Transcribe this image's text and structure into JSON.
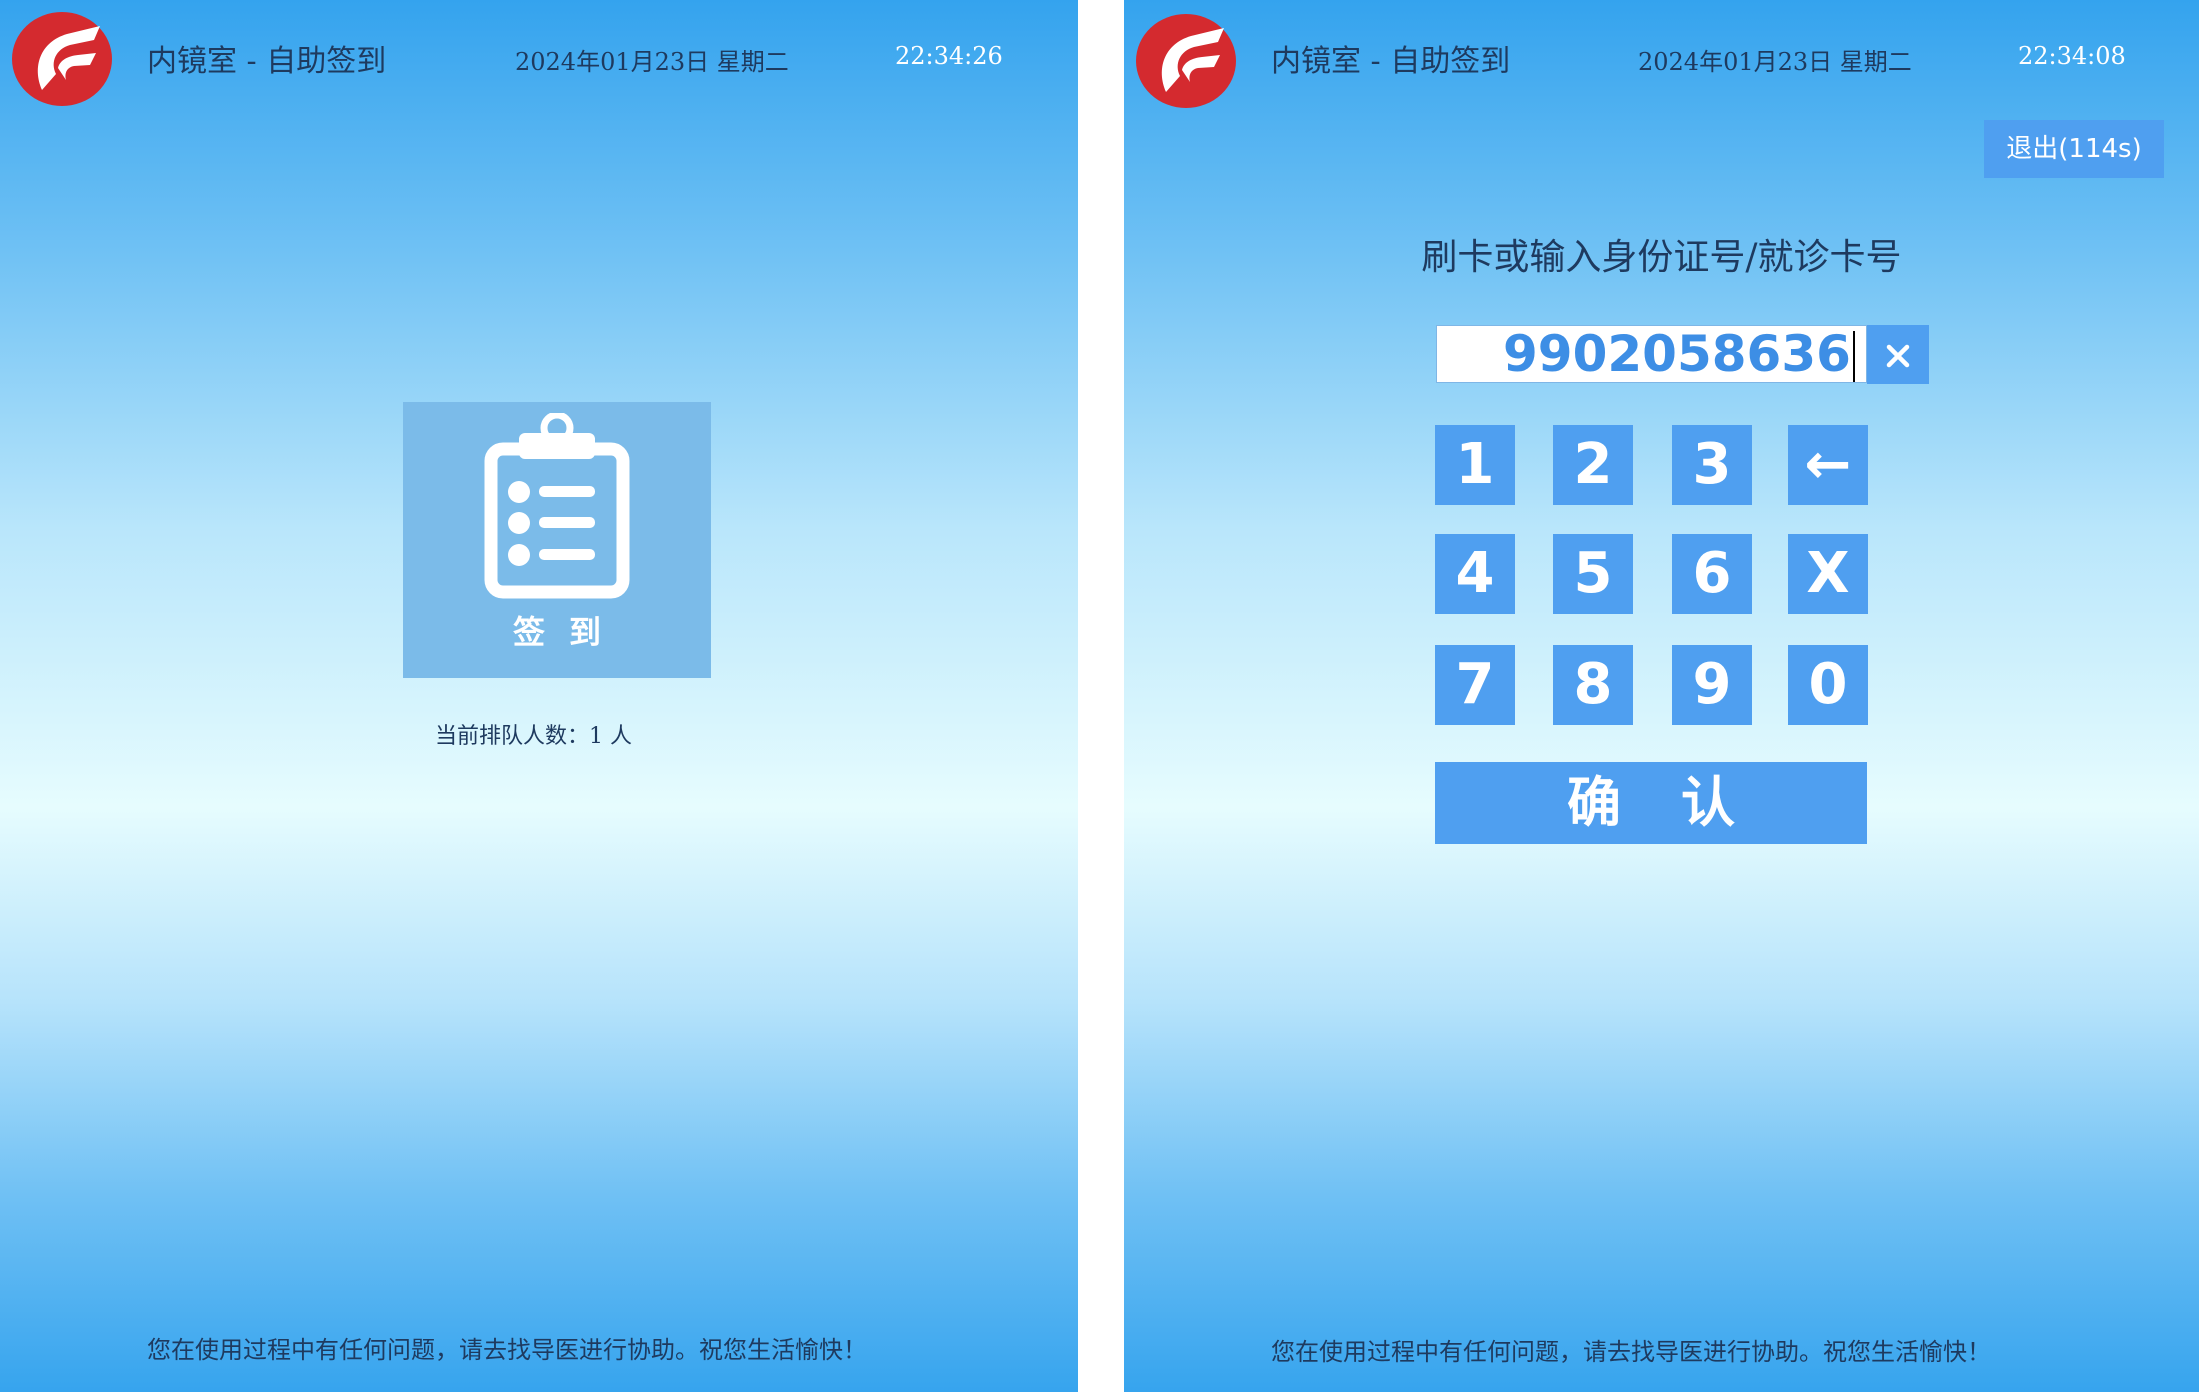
{
  "left_screen": {
    "header": {
      "title": "内镜室 - 自助签到",
      "date": "2024年01月23日 星期二",
      "time": "22:34:26"
    },
    "checkin_tile": {
      "label": "签到",
      "icon": "clipboard-list-icon"
    },
    "queue": {
      "text": "当前排队人数：1 人"
    },
    "footer": {
      "text": "您在使用过程中有任何问题，请去找导医进行协助。祝您生活愉快！"
    }
  },
  "right_screen": {
    "header": {
      "title": "内镜室 - 自助签到",
      "date": "2024年01月23日 星期二",
      "time": "22:34:08"
    },
    "exit_button": {
      "label": "退出(114s)"
    },
    "prompt": "刷卡或输入身份证号/就诊卡号",
    "input": {
      "value": "9902058636"
    },
    "clear_button": {
      "icon": "close-icon"
    },
    "keypad": {
      "keys": [
        "1",
        "2",
        "3",
        "←",
        "4",
        "5",
        "6",
        "X",
        "7",
        "8",
        "9",
        "0"
      ]
    },
    "confirm_button": {
      "label": "确认"
    },
    "footer": {
      "text": "您在使用过程中有任何问题，请去找导医进行协助。祝您生活愉快！"
    }
  },
  "colors": {
    "accent_blue": "#4f9ff0",
    "tile_blue": "#7bbbe9",
    "logo_red": "#d42a2f",
    "text_dark": "#1e3a5f"
  }
}
